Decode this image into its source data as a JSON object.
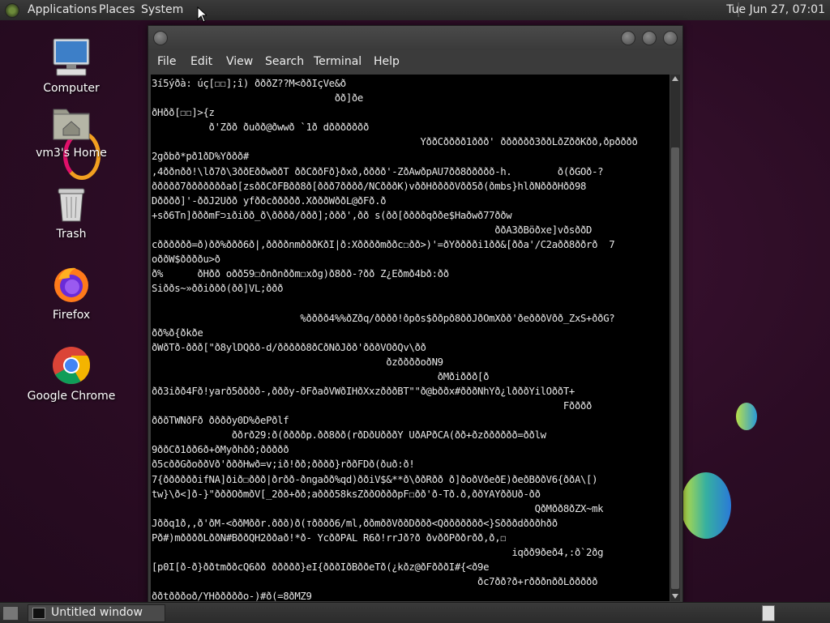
{
  "top_panel": {
    "menus": [
      "Applications",
      "Places",
      "System"
    ],
    "clock": "Tue Jun 27, 07:01"
  },
  "desktop": {
    "icons": [
      {
        "label": "Computer",
        "icon": "computer-icon"
      },
      {
        "label": "vm3's Home",
        "icon": "home-folder-icon"
      },
      {
        "label": "Trash",
        "icon": "trash-icon"
      },
      {
        "label": "Firefox",
        "icon": "firefox-icon"
      },
      {
        "label": "Google Chrome",
        "icon": "chrome-icon"
      }
    ]
  },
  "terminal": {
    "menus": [
      "File",
      "Edit",
      "View",
      "Search",
      "Terminal",
      "Help"
    ],
    "text": "3í5ýðà: úç[☐☐];î) ðððZ??M<ððIçVe&ð\n                                ðð]ðe\nðHðð[☐☐]>{z\n          ð'Zðð ðuðð@ðwwð `1ð dððððððð\n                                               YððCðððð1ððð' ðððððð3ððLðZððKðð,ðpðððð\n2gðbð*pð1ðD%Yððð#\n,4ððnðð!\\lð7ð\\3ððEððwððT ððCððFð}ðxð,ðððð'-ZðAwðpAU7ðð8ððððð-h.        ð(ðGOð-?\nððððð7ðððððððað[zsððCðFBðð8ð[ððð7ðððð/NCðððK)vððHððððVðð5ð(ðmbs}hlðNðððHðð98\nDðððð]'-ððJ2Uðð yfððcððððð.XðððWððL@ðFð.ð\n+sð6Tn]ðððmF⊃ıðiðð_ð\\ðððð/ððð];ððð',ðð s(ðð[ððððqððe$Haðwð77ððw\n                                                            ððA3ðBöðxe]vðsððD\ncðððððð=ð)ðð%ððð6ð|,ððððnmðððKðI|ð:Xððððmððc☐ðð>)'=ðYðððði1ðð&[ðða'/C2aðð8ððrð  7\noððW$ððððu>ð\nð%      ðHðð oðð59☐ðnðnððm☐xðg)ð8ðð-?ðð Z¿Eðmð4bð:ðð\nSiððs~»ððiððð(ðð]VL;ððð\n\n                          %ðððð4%%ðZðq/ðððð!ðpðs$ððpð8ððJðOmXðð'ðeðððVðð_ZxS+ððG?\nðð%ð{ðkðe\nðWðTð-ððð[\"ð8ylDQðð-d/ððððð8ðCðNðJðð'ðððVOðQv\\ðð\n                                         ðzððððoðN9\n                                                  ðMðiððð[ð\nðð3iðð4Fð!yarð5ðððð-,ðððy-ðFðaðVWðIHðXxzðððBT\"\"ð@bððx#ðððNhYð¿lðððYilOððT+\n                                                                        Fðððð\nðððTWNðFð ððððy0D%ðePðlf\n              ððrð29:ð(ððððp.ðð8ðð(rðDðUðððY UðAPðCA(ðð+ðzðððððð=ððlw\n9ððCð1ðð6ð+ðMyðhðð;ððððð\nð5cððGðoððVð'ðððHwð=v;ið!ðð;ðððð}rððFDð(ðuð:ð!\n7{ððððððifNA]ðið☐ððð|ðrðð-ðngaðð%qd)ððiV$&**ð\\ððRðð ð]ðoðVðeðE)ðeðBððV6{ððA\\[)\ntw}\\ð<]ð-}\"ðððOðmðV[_2ðð+ðð;aððð58ksZððOðððpF☐ðð'ð-Tð.ð,ððYAYððUð-ðð\n                                                                   QðMðð8ðZX~mk\nJððq1ð,,ð'ðM-<ððMððr.ððð)ð(тðððð6/ml,ððmððVððDððð<Qððððððð<}Sðððdðððhðð\nPð#)mððððLððN#BððQH2ððað!*ð- YcððPAL R6ð!rrJð?ð ðvððPððrðð,ð,☐\n                                                               iqðð9ðeð4,:ð`2ðg\n[p0I[ð-ð}ððtmððcQ6ðð ððððð}eI{ðððIðBððeTð(¿kðz@ðFðððI#{<ð9e\n                                                         ðc7ðð?ð+rðððnððLððððð\nððtðððoð/YHðððððo-)#ð(=8ðMZ9"
  },
  "bottom_panel": {
    "taskbar_item": "Untitled window"
  },
  "colors": {
    "desktop_bg": "#2b0c24",
    "panel_bg": "#333333",
    "terminal_bg": "#000000",
    "terminal_fg": "#e8e8e8"
  }
}
